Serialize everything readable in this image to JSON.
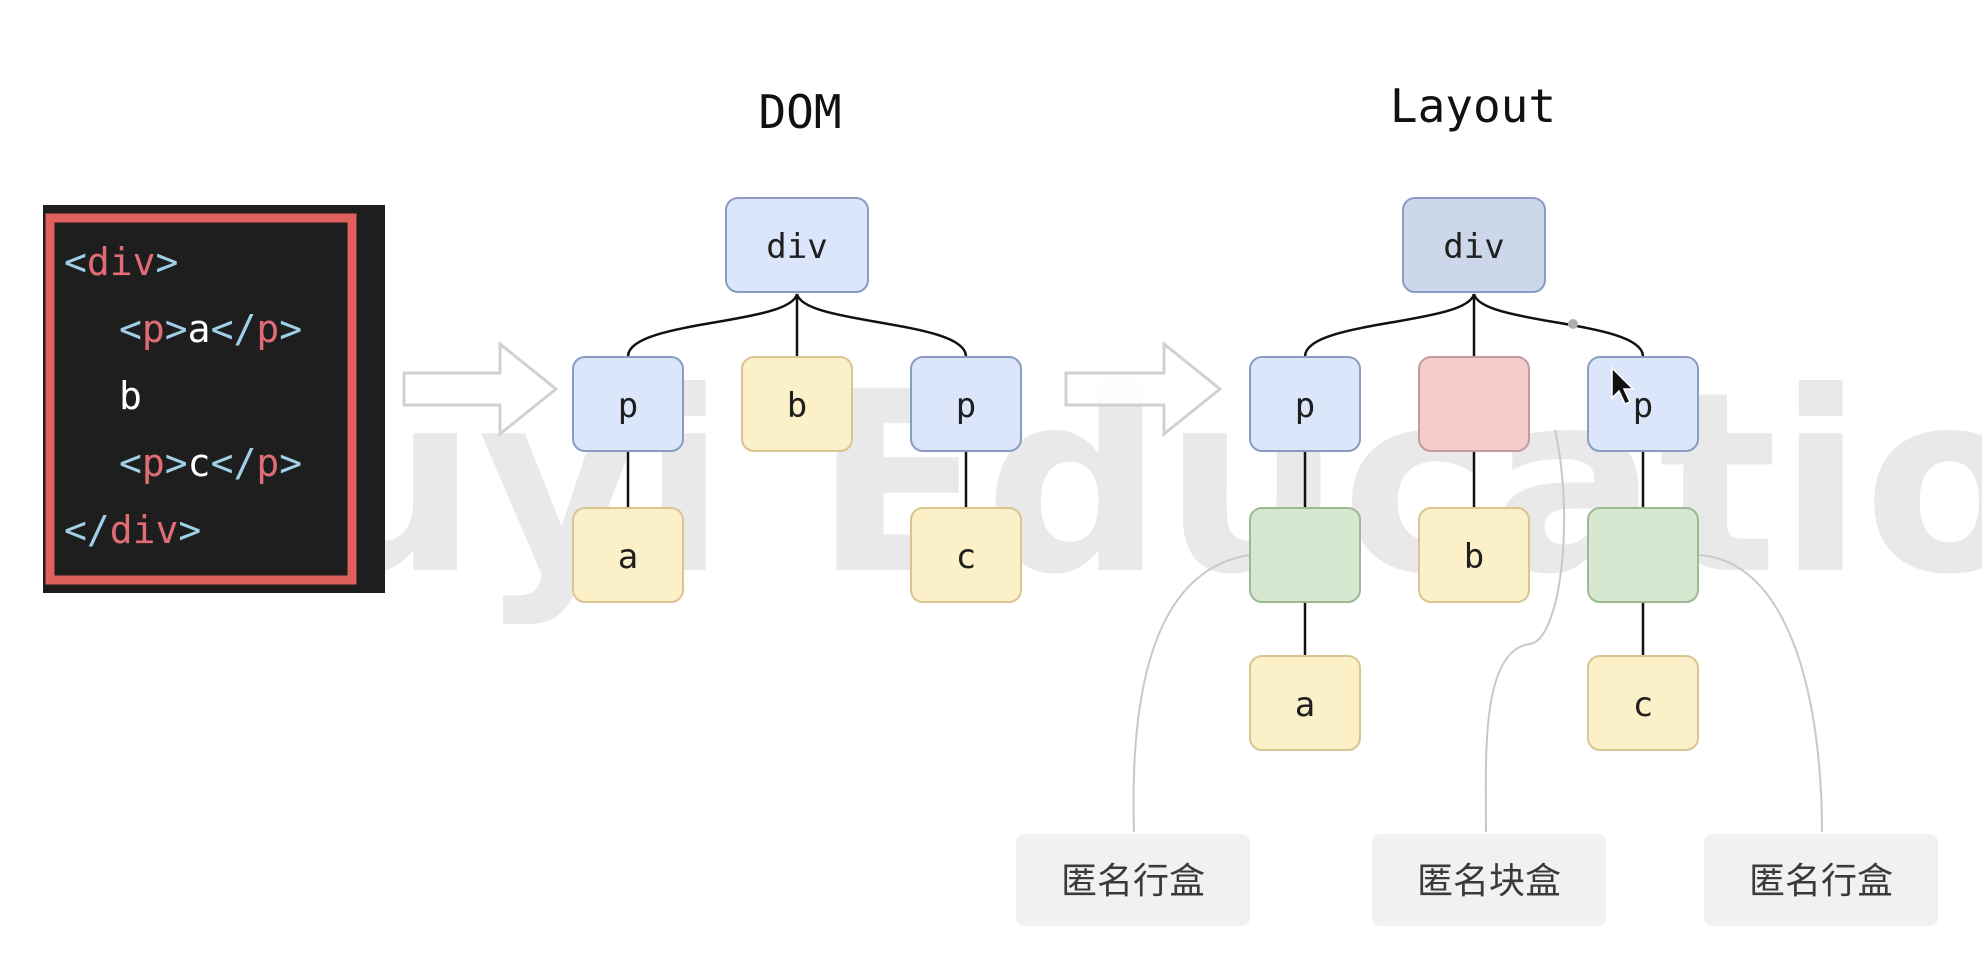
{
  "watermark": {
    "top": "",
    "bottom": "uyi Educatio"
  },
  "code_panel": {
    "lines": [
      {
        "tag_open": "<",
        "tag": "div",
        "tag_close": ">",
        "text": "",
        "end_open": "",
        "end_tag": "",
        "end_close": ""
      },
      {
        "tag_open": "<",
        "tag": "p",
        "tag_close": ">",
        "text": "a",
        "end_open": "</",
        "end_tag": "p",
        "end_close": ">"
      },
      {
        "tag_open": "",
        "tag": "",
        "tag_close": "",
        "text": "b",
        "end_open": "",
        "end_tag": "",
        "end_close": ""
      },
      {
        "tag_open": "<",
        "tag": "p",
        "tag_close": ">",
        "text": "c",
        "end_open": "</",
        "end_tag": "p",
        "end_close": ">"
      },
      {
        "tag_open": "</",
        "tag": "div",
        "tag_close": ">",
        "text": "",
        "end_open": "",
        "end_tag": "",
        "end_close": ""
      }
    ],
    "colors": {
      "background": "#1e1e1e",
      "border": "#e0605e",
      "bracket": "#9fd0e8",
      "tag": "#e06c75",
      "text": "#ffffff"
    }
  },
  "dom_tree": {
    "title": "DOM",
    "root": "div",
    "children": [
      "p",
      "b",
      "p"
    ],
    "grandchildren": [
      "a",
      "c"
    ]
  },
  "layout_tree": {
    "title": "Layout",
    "root": "div",
    "children": [
      "p",
      "",
      "p"
    ],
    "mid": [
      "",
      "b",
      ""
    ],
    "leaves": [
      "a",
      "c"
    ]
  },
  "captions": [
    "匿名行盒",
    "匿名块盒",
    "匿名行盒"
  ],
  "colors": {
    "element_fill": "#dbe6fb",
    "element_stroke": "#8a9cc4",
    "root_layout_fill": "#cdd7ea",
    "text_fill": "#fcf0c8",
    "text_stroke": "#d9c591",
    "anon_line_fill": "#d6e8cf",
    "anon_line_stroke": "#9cb894",
    "anon_block_fill": "#f4cccc",
    "anon_block_stroke": "#c49a9a",
    "caption_fill": "#f1f1f1"
  }
}
